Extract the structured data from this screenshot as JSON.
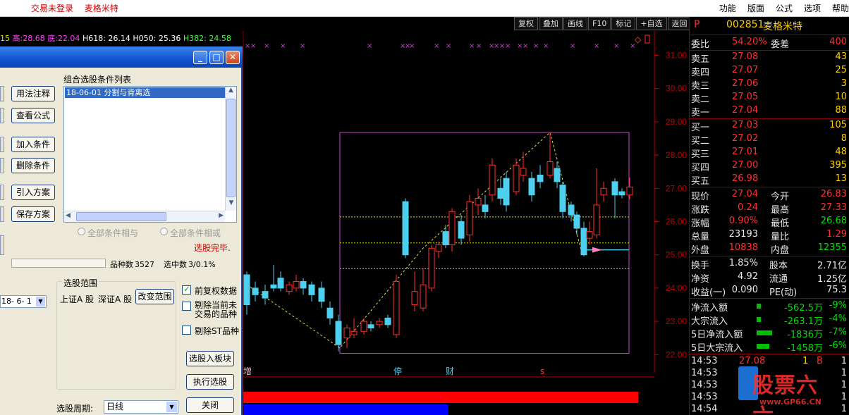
{
  "topbar": {
    "status": "交易未登录",
    "stock_name": "麦格米特",
    "menu": [
      "功能",
      "版面",
      "公式",
      "选项",
      "帮助"
    ]
  },
  "chart_toolbar": [
    "复权",
    "叠加",
    "画线",
    "F10",
    "标记",
    "+自选",
    "返回"
  ],
  "indicator": {
    "prefix": "15",
    "high_label": "高:",
    "high_val": "28.68",
    "low_label": "底:",
    "low_val": "22.04",
    "h618": "H618: 26.14",
    "h050": "H050: 25.36",
    "h382": "H382: 24.58"
  },
  "price_axis": [
    "31.00",
    "30.00",
    "29.00",
    "28.00",
    "27.00",
    "26.00",
    "25.00",
    "24.00",
    "23.00",
    "22.00"
  ],
  "bottom_labels": {
    "zeng": "增",
    "ting": "停",
    "cai": "财",
    "s": "s"
  },
  "quote": {
    "code": "002851",
    "name": "麦格米特",
    "mark": "P",
    "weibi_label": "委比",
    "weibi_val": "54.20%",
    "weicha_label": "委差",
    "weicha_val": "400",
    "asks": [
      {
        "label": "卖五",
        "price": "27.08",
        "vol": "43"
      },
      {
        "label": "卖四",
        "price": "27.07",
        "vol": "25"
      },
      {
        "label": "卖三",
        "price": "27.06",
        "vol": "3"
      },
      {
        "label": "卖二",
        "price": "27.05",
        "vol": "10"
      },
      {
        "label": "卖一",
        "price": "27.04",
        "vol": "88"
      }
    ],
    "bids": [
      {
        "label": "买一",
        "price": "27.03",
        "vol": "105"
      },
      {
        "label": "买二",
        "price": "27.02",
        "vol": "8"
      },
      {
        "label": "买三",
        "price": "27.01",
        "vol": "48"
      },
      {
        "label": "买四",
        "price": "27.00",
        "vol": "395"
      },
      {
        "label": "买五",
        "price": "26.98",
        "vol": "13"
      }
    ],
    "stats": [
      {
        "l1": "现价",
        "v1": "27.04",
        "l2": "今开",
        "v2": "26.83"
      },
      {
        "l1": "涨跌",
        "v1": "0.24",
        "l2": "最高",
        "v2": "27.33"
      },
      {
        "l1": "涨幅",
        "v1": "0.90%",
        "l2": "最低",
        "v2": "26.68"
      },
      {
        "l1": "总量",
        "v1": "23193",
        "l2": "量比",
        "v2": "1.29"
      },
      {
        "l1": "外盘",
        "v1": "10838",
        "l2": "内盘",
        "v2": "12355"
      }
    ],
    "stats2": [
      {
        "l1": "换手",
        "v1": "1.85%",
        "l2": "股本",
        "v2": "2.71亿"
      },
      {
        "l1": "净资",
        "v1": "4.92",
        "l2": "流通",
        "v2": "1.25亿"
      },
      {
        "l1": "收益(一)",
        "v1": "0.090",
        "l2": "PE(动)",
        "v2": "75.3"
      }
    ],
    "flows": [
      {
        "label": "净流入额",
        "val": "-562.5万",
        "pct": "-9%"
      },
      {
        "label": "大宗流入",
        "val": "-263.1万",
        "pct": "-4%"
      },
      {
        "label": "5日净流入额",
        "val": "-1836万",
        "pct": "-7%"
      },
      {
        "label": "5日大宗流入",
        "val": "-1458万",
        "pct": "-6%"
      }
    ],
    "ticks": [
      {
        "time": "14:53",
        "price": "27.08",
        "vol": "1",
        "side": "B",
        "n": "1"
      },
      {
        "time": "14:53",
        "price": "",
        "vol": "",
        "side": "",
        "n": "1"
      },
      {
        "time": "14:53",
        "price": "",
        "vol": "",
        "side": "",
        "n": "1"
      },
      {
        "time": "14:53",
        "price": "",
        "vol": "",
        "side": "",
        "n": "1"
      },
      {
        "time": "14:54",
        "price": "",
        "vol": "",
        "side": "",
        "n": "1"
      }
    ]
  },
  "watermark": {
    "title": "股票六六",
    "url": "www.GP66.CN"
  },
  "dialog": {
    "list_title": "组合选股条件列表",
    "list_items": [
      "18-06-01 分割与背离选"
    ],
    "buttons_left": [
      "用法注释",
      "查看公式",
      "加入条件",
      "删除条件",
      "引入方案",
      "保存方案"
    ],
    "radio_all_and": "全部条件相与",
    "radio_all_or": "全部条件相或",
    "status": "选股完毕.",
    "count_label": "品种数",
    "count_val": "3527",
    "selected_label": "选中数",
    "selected_val": "3/0.1%",
    "range_title": "选股范围",
    "range_sh": "上证A 股",
    "range_sz": "深证A 股",
    "change_range": "改变范围",
    "date_value": "18- 6- 1",
    "opt_prefuquan": "前复权数据",
    "opt_remove_suspend_1": "剔除当前未",
    "opt_remove_suspend_2": "交易的品种",
    "opt_remove_st": "剔除ST品种",
    "btn_to_block": "选股入板块",
    "btn_exec": "执行选股",
    "btn_close": "关闭",
    "period_label": "选股周期:",
    "period_value": "日线"
  },
  "colors": {
    "up": "#ff3030",
    "down": "#4dd0f0",
    "box": "#d040d0",
    "ma": "#d0d000",
    "axis": "#c00000"
  }
}
